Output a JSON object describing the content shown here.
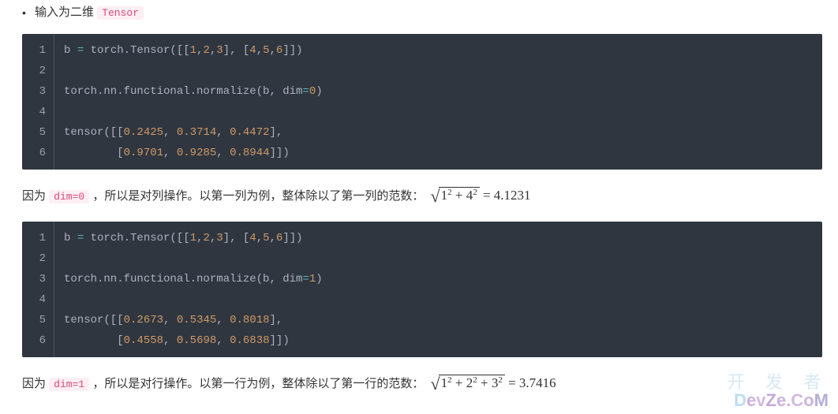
{
  "bullet": {
    "prefix": "输入为二维",
    "code": "Tensor"
  },
  "code_blocks": [
    {
      "lines": [
        [
          {
            "t": "b ",
            "c": "tk-id"
          },
          {
            "t": "=",
            "c": "tk-op"
          },
          {
            "t": " torch.Tensor([[",
            "c": "tk-id"
          },
          {
            "t": "1",
            "c": "tk-num"
          },
          {
            "t": ",",
            "c": "tk-pn"
          },
          {
            "t": "2",
            "c": "tk-num"
          },
          {
            "t": ",",
            "c": "tk-pn"
          },
          {
            "t": "3",
            "c": "tk-num"
          },
          {
            "t": "], [",
            "c": "tk-id"
          },
          {
            "t": "4",
            "c": "tk-num"
          },
          {
            "t": ",",
            "c": "tk-pn"
          },
          {
            "t": "5",
            "c": "tk-num"
          },
          {
            "t": ",",
            "c": "tk-pn"
          },
          {
            "t": "6",
            "c": "tk-num"
          },
          {
            "t": "]])",
            "c": "tk-id"
          }
        ],
        [],
        [
          {
            "t": "torch.nn.functional.normalize(b, dim",
            "c": "tk-id"
          },
          {
            "t": "=",
            "c": "tk-op"
          },
          {
            "t": "0",
            "c": "tk-num"
          },
          {
            "t": ")",
            "c": "tk-id"
          }
        ],
        [],
        [
          {
            "t": "tensor([[",
            "c": "tk-id"
          },
          {
            "t": "0.2425",
            "c": "tk-num"
          },
          {
            "t": ", ",
            "c": "tk-pn"
          },
          {
            "t": "0.3714",
            "c": "tk-num"
          },
          {
            "t": ", ",
            "c": "tk-pn"
          },
          {
            "t": "0.4472",
            "c": "tk-num"
          },
          {
            "t": "],",
            "c": "tk-id"
          }
        ],
        [
          {
            "t": "        [",
            "c": "tk-id"
          },
          {
            "t": "0.9701",
            "c": "tk-num"
          },
          {
            "t": ", ",
            "c": "tk-pn"
          },
          {
            "t": "0.9285",
            "c": "tk-num"
          },
          {
            "t": ", ",
            "c": "tk-pn"
          },
          {
            "t": "0.8944",
            "c": "tk-num"
          },
          {
            "t": "]])",
            "c": "tk-id"
          }
        ]
      ]
    },
    {
      "lines": [
        [
          {
            "t": "b ",
            "c": "tk-id"
          },
          {
            "t": "=",
            "c": "tk-op"
          },
          {
            "t": " torch.Tensor([[",
            "c": "tk-id"
          },
          {
            "t": "1",
            "c": "tk-num"
          },
          {
            "t": ",",
            "c": "tk-pn"
          },
          {
            "t": "2",
            "c": "tk-num"
          },
          {
            "t": ",",
            "c": "tk-pn"
          },
          {
            "t": "3",
            "c": "tk-num"
          },
          {
            "t": "], [",
            "c": "tk-id"
          },
          {
            "t": "4",
            "c": "tk-num"
          },
          {
            "t": ",",
            "c": "tk-pn"
          },
          {
            "t": "5",
            "c": "tk-num"
          },
          {
            "t": ",",
            "c": "tk-pn"
          },
          {
            "t": "6",
            "c": "tk-num"
          },
          {
            "t": "]])",
            "c": "tk-id"
          }
        ],
        [],
        [
          {
            "t": "torch.nn.functional.normalize(b, dim",
            "c": "tk-id"
          },
          {
            "t": "=",
            "c": "tk-op"
          },
          {
            "t": "1",
            "c": "tk-num"
          },
          {
            "t": ")",
            "c": "tk-id"
          }
        ],
        [],
        [
          {
            "t": "tensor([[",
            "c": "tk-id"
          },
          {
            "t": "0.2673",
            "c": "tk-num"
          },
          {
            "t": ", ",
            "c": "tk-pn"
          },
          {
            "t": "0.5345",
            "c": "tk-num"
          },
          {
            "t": ", ",
            "c": "tk-pn"
          },
          {
            "t": "0.8018",
            "c": "tk-num"
          },
          {
            "t": "],",
            "c": "tk-id"
          }
        ],
        [
          {
            "t": "        [",
            "c": "tk-id"
          },
          {
            "t": "0.4558",
            "c": "tk-num"
          },
          {
            "t": ", ",
            "c": "tk-pn"
          },
          {
            "t": "0.5698",
            "c": "tk-num"
          },
          {
            "t": ", ",
            "c": "tk-pn"
          },
          {
            "t": "0.6838",
            "c": "tk-num"
          },
          {
            "t": "]])",
            "c": "tk-id"
          }
        ]
      ]
    }
  ],
  "para1": {
    "prefix": "因为 ",
    "code": "dim=0",
    "mid": " ，所以是对列操作。以第一列为例，整体除以了第一列的范数：",
    "formula": {
      "terms": [
        "1",
        "4"
      ],
      "result": "4.1231"
    }
  },
  "para2": {
    "prefix": "因为 ",
    "code": "dim=1",
    "mid": " ，所以是对行操作。以第一行为例，整体除以了第一行的范数：",
    "formula": {
      "terms": [
        "1",
        "2",
        "3"
      ],
      "result": "3.7416"
    }
  },
  "watermark": {
    "cn": "开 发 者",
    "en": "DevZe.CoM"
  }
}
